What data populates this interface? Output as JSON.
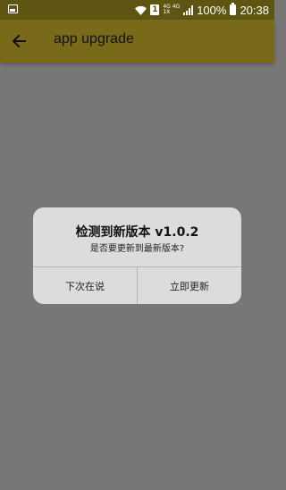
{
  "status_bar": {
    "network_top": "4G 4G",
    "network_bottom": "1X",
    "sim_label": "1",
    "battery_percent": "100%",
    "time": "20:38",
    "icons": [
      "image-icon",
      "wifi-icon",
      "sim-icon",
      "signal-icon",
      "battery-icon"
    ]
  },
  "app_bar": {
    "title": "app upgrade",
    "back_icon": "arrow-left-icon"
  },
  "dialog": {
    "title": "检测到新版本 v1.0.2",
    "message": "是否要更新到最新版本?",
    "buttons": {
      "later": "下次在说",
      "update": "立即更新"
    }
  },
  "colors": {
    "status_bar": "#5f5512",
    "app_bar": "#786a18",
    "scrim": "#777777",
    "dialog_bg": "#dcdcdc"
  }
}
